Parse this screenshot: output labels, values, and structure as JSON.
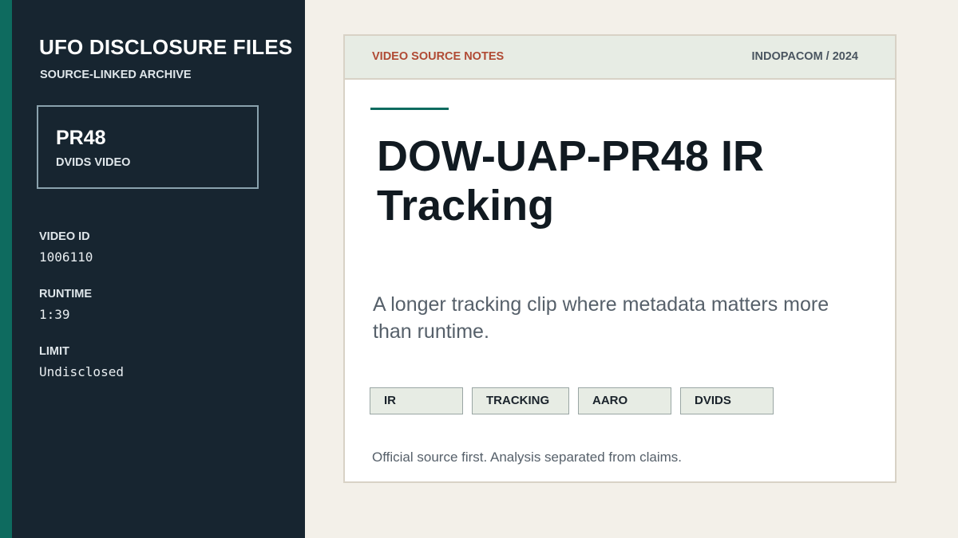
{
  "sidebar": {
    "title": "UFO DISCLOSURE FILES",
    "subtitle": "SOURCE-LINKED ARCHIVE",
    "id_card": {
      "code": "PR48",
      "type": "DVIDS VIDEO"
    },
    "meta": [
      {
        "label": "VIDEO ID",
        "value": "1006110"
      },
      {
        "label": "RUNTIME",
        "value": "1:39"
      },
      {
        "label": "LIMIT",
        "value": "Undisclosed"
      }
    ]
  },
  "card": {
    "header_left": "VIDEO SOURCE NOTES",
    "header_right": "INDOPACOM / 2024",
    "title": "DOW-UAP-PR48 IR Tracking",
    "description": "A longer tracking clip where metadata matters more than runtime.",
    "tags": [
      "IR",
      "TRACKING",
      "AARO",
      "DVIDS"
    ],
    "footnote": "Official source first. Analysis separated from claims."
  },
  "colors": {
    "accent": "#0e6b5f",
    "sidebar_bg": "#172530",
    "header_label": "#b04a34",
    "page_bg": "#f3f0e9"
  }
}
